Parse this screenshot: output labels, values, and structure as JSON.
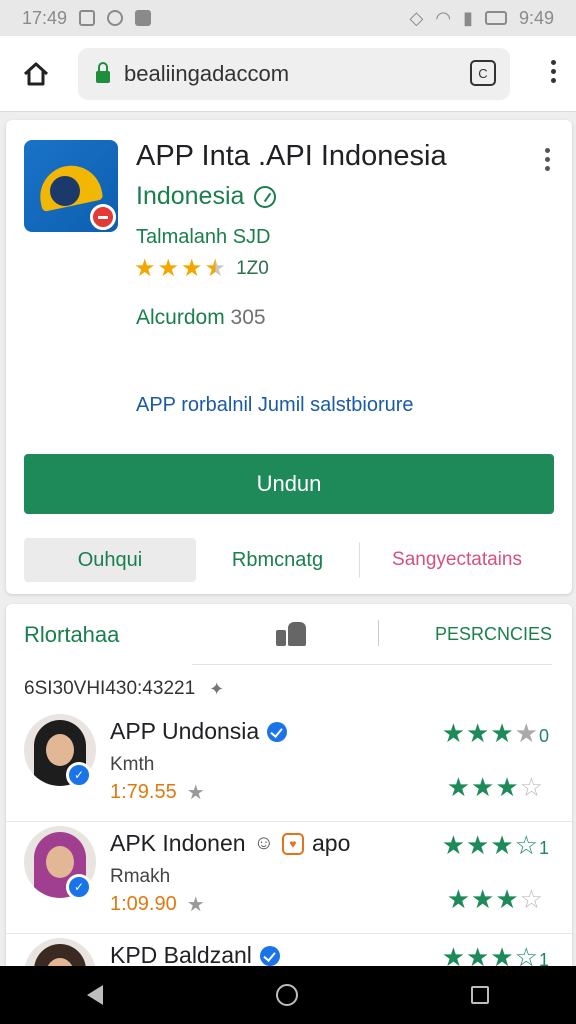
{
  "status_bar": {
    "time": "17:49",
    "battery_time": "9:49"
  },
  "browser": {
    "url": "bealiingadaccom",
    "tab_count": "C"
  },
  "app": {
    "title": "APP Inta .API Indonesia",
    "developer": "Indonesia",
    "subtitle": "Talmalanh SJD",
    "rating_count": "1Z0",
    "category_label": "Alcurdom",
    "category_number": "305",
    "description_link": "APP rorbalnil Jumil salstbiorure",
    "install_label": "Undun",
    "actions": [
      "Ouhqui",
      "Rbmcnatg",
      "Sangyectatains"
    ]
  },
  "reviews_section": {
    "title": "Rlortahaa",
    "right_label": "PESRCNCIES",
    "filter_text": "6SI30VHI430:43221"
  },
  "reviews": [
    {
      "name": "APP Undonsia",
      "sub": "Kmth",
      "date": "1:79.55",
      "top_suffix": "0"
    },
    {
      "name": "APK Indonen",
      "extra": "apo",
      "sub": "Rmakh",
      "date": "1:09.90",
      "top_suffix": "1"
    },
    {
      "name": "KPD Baldzanl",
      "top_suffix": "1"
    }
  ],
  "colors": {
    "accent_green": "#1e8a5a",
    "link_blue": "#1a5aa8",
    "pink": "#d6517a",
    "star_gold": "#f2a600"
  }
}
